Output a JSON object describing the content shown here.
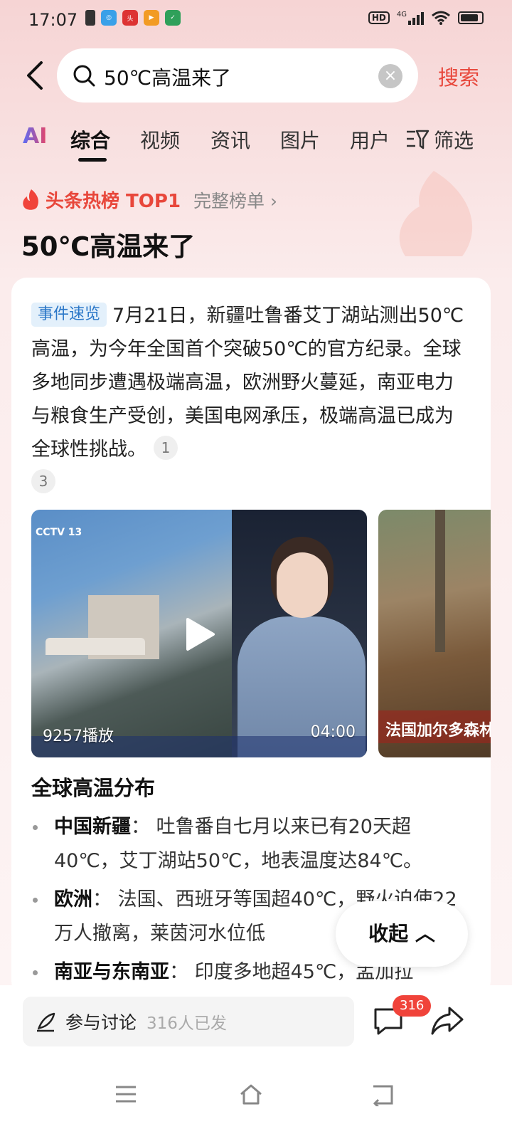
{
  "status_bar": {
    "time": "17:07",
    "hd": "HD",
    "network": "4G"
  },
  "search": {
    "query": "50℃高温来了",
    "button": "搜索"
  },
  "tabs": {
    "ai": "AI",
    "items": [
      "综合",
      "视频",
      "资讯",
      "图片",
      "用户"
    ],
    "active": "综合",
    "filter": "筛选"
  },
  "hot": {
    "title": "头条热榜 TOP1",
    "link": "完整榜单"
  },
  "page_title": "50℃高温来了",
  "summary": {
    "tag": "事件速览",
    "text": "7月21日，新疆吐鲁番艾丁湖站测出50℃高温，为今年全国首个突破50℃的官方纪录。全球多地同步遭遇极端高温，欧洲野火蔓延，南亚电力与粮食生产受创，美国电网承压，极端高温已成为全球性挑战。",
    "refs": [
      "1",
      "3"
    ]
  },
  "videos": [
    {
      "logo": "CCTV 13",
      "plays": "9257播放",
      "duration": "04:00"
    },
    {
      "caption": "法国加尔多森林"
    }
  ],
  "section_title": "全球高温分布",
  "bullets": [
    {
      "label": "中国新疆",
      "sep": "：",
      "text": "吐鲁番自七月以来已有20天超40℃，艾丁湖站50℃，地表温度达84℃。"
    },
    {
      "label": "欧洲",
      "sep": "：",
      "text": "法国、西班牙等国超40℃，野火迫使22万人撤离，莱茵河水位低"
    },
    {
      "label": "南亚与东南亚",
      "sep": "：",
      "text": "印度多地超45℃，孟加拉"
    }
  ],
  "collapse": {
    "label": "收起"
  },
  "bottom": {
    "discuss_label": "参与讨论",
    "discuss_count": "316人已发",
    "comment_badge": "316"
  },
  "colors": {
    "accent": "#e8473b",
    "tag_bg": "#e3f0fb",
    "tag_text": "#2b77c8"
  }
}
